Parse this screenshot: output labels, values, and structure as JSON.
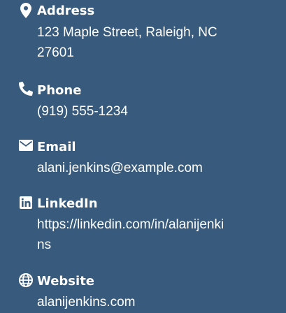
{
  "colors": {
    "background": "#385a7c",
    "text": "#ffffff"
  },
  "contacts": [
    {
      "icon": "map-pin-icon",
      "label": "Address",
      "value_line1": "123 Maple Street, Raleigh, NC",
      "value_line2": "27601"
    },
    {
      "icon": "phone-icon",
      "label": "Phone",
      "value_line1": "(919) 555-1234"
    },
    {
      "icon": "envelope-icon",
      "label": "Email",
      "value_line1": "alani.jenkins@example.com"
    },
    {
      "icon": "linkedin-icon",
      "label": "LinkedIn",
      "value_line1": "https://linkedin.com/in/alanijenki",
      "value_line2": "ns"
    },
    {
      "icon": "globe-icon",
      "label": "Website",
      "value_line1": "alanijenkins.com"
    }
  ]
}
